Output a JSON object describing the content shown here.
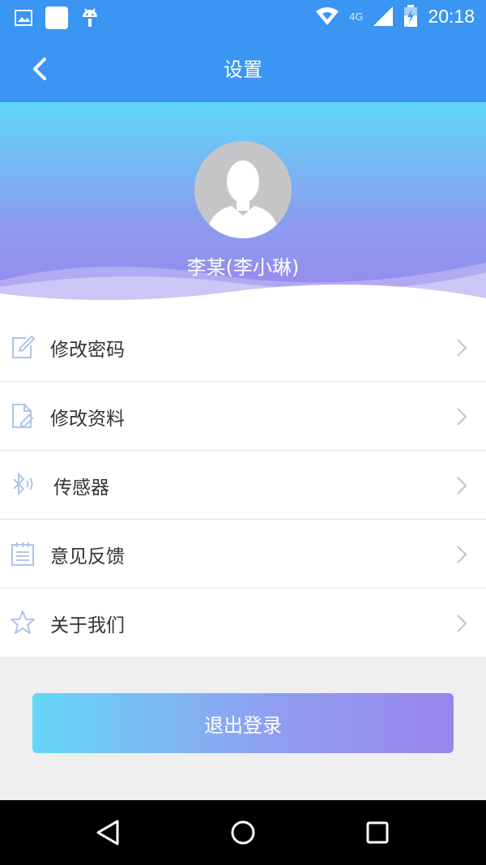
{
  "status_bar": {
    "time": "20:18",
    "network": "4G",
    "icons": [
      "image-icon",
      "app-square-icon",
      "android-icon",
      "wifi-icon",
      "signal-icon",
      "battery-charging-icon"
    ]
  },
  "app_bar": {
    "title": "设置",
    "back_icon": "chevron-left-icon"
  },
  "profile": {
    "name": "李某(李小琳)",
    "avatar_icon": "person-silhouette-icon"
  },
  "menu": {
    "items": [
      {
        "label": "修改密码",
        "icon": "edit-icon"
      },
      {
        "label": "修改资料",
        "icon": "document-edit-icon"
      },
      {
        "label": "传感器",
        "icon": "bluetooth-icon"
      },
      {
        "label": "意见反馈",
        "icon": "notepad-icon"
      },
      {
        "label": "关于我们",
        "icon": "star-icon"
      }
    ]
  },
  "logout": {
    "label": "退出登录"
  },
  "nav_bar": {
    "buttons": [
      "back-triangle-icon",
      "home-circle-icon",
      "recents-square-icon"
    ]
  },
  "colors": {
    "primary": "#3b95f2",
    "gradient_start": "#5fd7f8",
    "gradient_end": "#9b86ec"
  }
}
